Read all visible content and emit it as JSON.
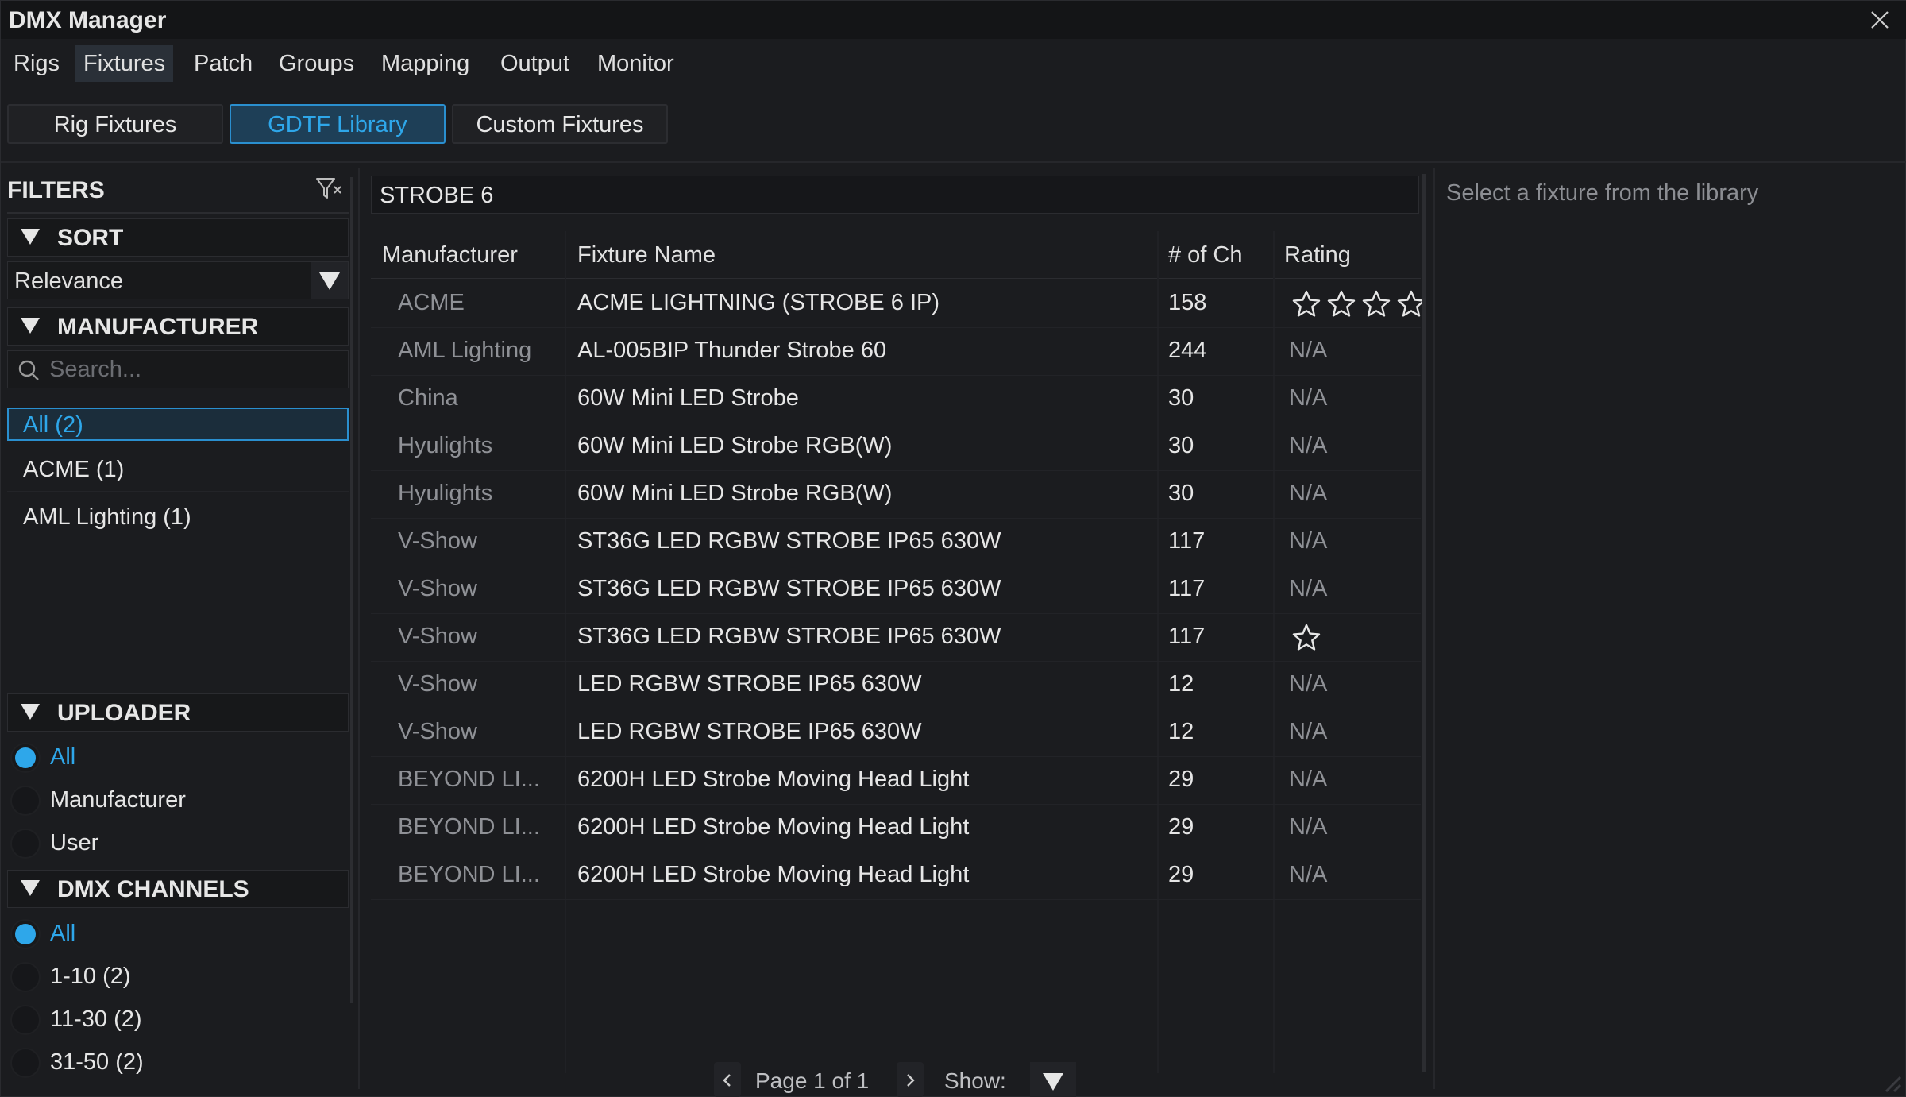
{
  "window": {
    "title": "DMX Manager"
  },
  "main_nav": [
    {
      "label": "Rigs",
      "active": false
    },
    {
      "label": "Fixtures",
      "active": true
    },
    {
      "label": "Patch",
      "active": false
    },
    {
      "label": "Groups",
      "active": false
    },
    {
      "label": "Mapping",
      "active": false
    },
    {
      "label": "Output",
      "active": false
    },
    {
      "label": "Monitor",
      "active": false
    }
  ],
  "sub_tabs": [
    {
      "label": "Rig Fixtures",
      "active": false
    },
    {
      "label": "GDTF Library",
      "active": true
    },
    {
      "label": "Custom Fixtures",
      "active": false
    }
  ],
  "filters": {
    "title": "FILTERS",
    "sort": {
      "heading": "SORT",
      "selected": "Relevance"
    },
    "manufacturer": {
      "heading": "MANUFACTURER",
      "search_placeholder": "Search...",
      "items": [
        {
          "label": "All (2)",
          "selected": true
        },
        {
          "label": "ACME (1)",
          "selected": false
        },
        {
          "label": "AML Lighting (1)",
          "selected": false
        }
      ]
    },
    "uploader": {
      "heading": "UPLOADER",
      "options": [
        {
          "label": "All",
          "selected": true
        },
        {
          "label": "Manufacturer",
          "selected": false
        },
        {
          "label": "User",
          "selected": false
        }
      ]
    },
    "dmx_channels": {
      "heading": "DMX CHANNELS",
      "options": [
        {
          "label": "All",
          "selected": true
        },
        {
          "label": "1-10 (2)",
          "selected": false
        },
        {
          "label": "11-30 (2)",
          "selected": false
        },
        {
          "label": "31-50 (2)",
          "selected": false
        }
      ]
    }
  },
  "library": {
    "query": "STROBE 6",
    "columns": {
      "manufacturer": "Manufacturer",
      "name": "Fixture Name",
      "channels": "# of Ch",
      "rating": "Rating"
    },
    "rows": [
      {
        "manufacturer": "ACME",
        "name": " ACME LIGHTNING (STROBE 6 IP)",
        "channels": "158",
        "rating": "",
        "stars": 4
      },
      {
        "manufacturer": "AML Lighting",
        "name": "AL-005BIP Thunder Strobe 60",
        "channels": "244",
        "rating": "N/A",
        "stars": 0
      },
      {
        "manufacturer": "China",
        "name": "60W Mini LED Strobe",
        "channels": "30",
        "rating": "N/A",
        "stars": 0
      },
      {
        "manufacturer": "Hyulights",
        "name": "60W Mini LED Strobe RGB(W)",
        "channels": "30",
        "rating": "N/A",
        "stars": 0
      },
      {
        "manufacturer": "Hyulights",
        "name": "60W Mini LED Strobe RGB(W)",
        "channels": "30",
        "rating": "N/A",
        "stars": 0
      },
      {
        "manufacturer": "V-Show",
        "name": "ST36G LED RGBW STROBE IP65 630W",
        "channels": "117",
        "rating": "N/A",
        "stars": 0
      },
      {
        "manufacturer": "V-Show",
        "name": "ST36G LED RGBW STROBE IP65 630W",
        "channels": "117",
        "rating": "N/A",
        "stars": 0
      },
      {
        "manufacturer": "V-Show",
        "name": "ST36G LED RGBW STROBE IP65 630W",
        "channels": "117",
        "rating": "",
        "stars": 1
      },
      {
        "manufacturer": "V-Show",
        "name": "LED RGBW STROBE IP65 630W",
        "channels": "12",
        "rating": "N/A",
        "stars": 0
      },
      {
        "manufacturer": "V-Show",
        "name": "LED RGBW STROBE IP65 630W",
        "channels": "12",
        "rating": "N/A",
        "stars": 0
      },
      {
        "manufacturer": "BEYOND LI...",
        "name": "6200H LED Strobe Moving Head Light",
        "channels": "29",
        "rating": "N/A",
        "stars": 0
      },
      {
        "manufacturer": "BEYOND LI...",
        "name": "6200H LED Strobe Moving Head Light",
        "channels": "29",
        "rating": "N/A",
        "stars": 0
      },
      {
        "manufacturer": "BEYOND LI...",
        "name": "6200H LED Strobe Moving Head Light",
        "channels": "29",
        "rating": "N/A",
        "stars": 0
      }
    ],
    "pager": {
      "page_text": "Page 1 of 1",
      "show_label": "Show:"
    }
  },
  "details": {
    "hint": "Select a fixture from the library"
  },
  "colors": {
    "accent": "#2ea7ea",
    "background": "#1b1c1f",
    "muted_text": "#8f9196"
  }
}
